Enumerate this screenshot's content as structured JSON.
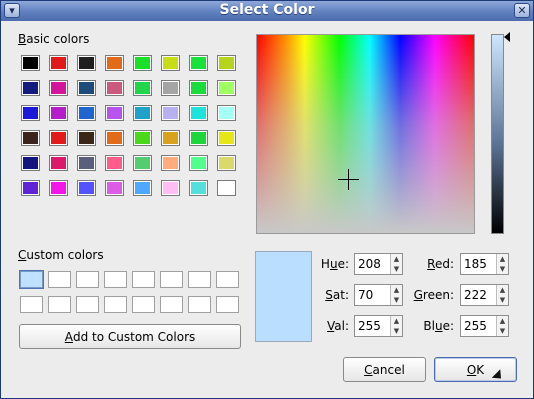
{
  "window": {
    "title": "Select Color"
  },
  "basic_colors": {
    "label_prefix": "",
    "label_u": "B",
    "label_rest": "asic colors",
    "swatches": [
      "#000000",
      "#e11b1b",
      "#1f1f1f",
      "#e26b1a",
      "#1ae02a",
      "#c7dd17",
      "#16e238",
      "#b7d41d",
      "#151a7e",
      "#d3159a",
      "#1f4b78",
      "#cc5a7f",
      "#22d64a",
      "#a5a5a5",
      "#17de3a",
      "#9eff63",
      "#1b18d8",
      "#b41ec8",
      "#2064d0",
      "#b853ee",
      "#1ea2c8",
      "#b8b1f0",
      "#1ce4db",
      "#a6fff7",
      "#3b241b",
      "#e11b1b",
      "#3a2718",
      "#e16b1b",
      "#48d91b",
      "#d9a21b",
      "#1cd63a",
      "#e6e617",
      "#14147f",
      "#dc1a6b",
      "#5a5f7d",
      "#ff5c8c",
      "#52cd6f",
      "#ffab7d",
      "#51ff8c",
      "#d9d96c",
      "#6123d6",
      "#f316e8",
      "#5252ff",
      "#dc5ce6",
      "#4fa8ff",
      "#ffbdf3",
      "#54dedc",
      "#ffffff"
    ]
  },
  "custom_colors": {
    "label_u": "C",
    "label_rest": "ustom colors",
    "count": 16
  },
  "buttons": {
    "add_custom_u": "A",
    "add_custom_rest": "dd to Custom Colors",
    "cancel_u": "C",
    "cancel_rest": "ancel",
    "ok_u": "O",
    "ok_rest": "K"
  },
  "fields": {
    "hue": {
      "label_u": "u",
      "label_pre": "H",
      "label_post": "e:",
      "value": "208"
    },
    "sat": {
      "label_u": "S",
      "label_pre": "",
      "label_post": "at:",
      "value": "70"
    },
    "val": {
      "label_u": "V",
      "label_pre": "",
      "label_post": "al:",
      "value": "255"
    },
    "red": {
      "label_u": "R",
      "label_pre": "",
      "label_post": "ed:",
      "value": "185"
    },
    "green": {
      "label_u": "G",
      "label_pre": "",
      "label_post": "reen:",
      "value": "222"
    },
    "blue": {
      "label_u": "u",
      "label_pre": "Bl",
      "label_post": "e:",
      "value": "255"
    }
  },
  "preview_color": "#b9deff"
}
